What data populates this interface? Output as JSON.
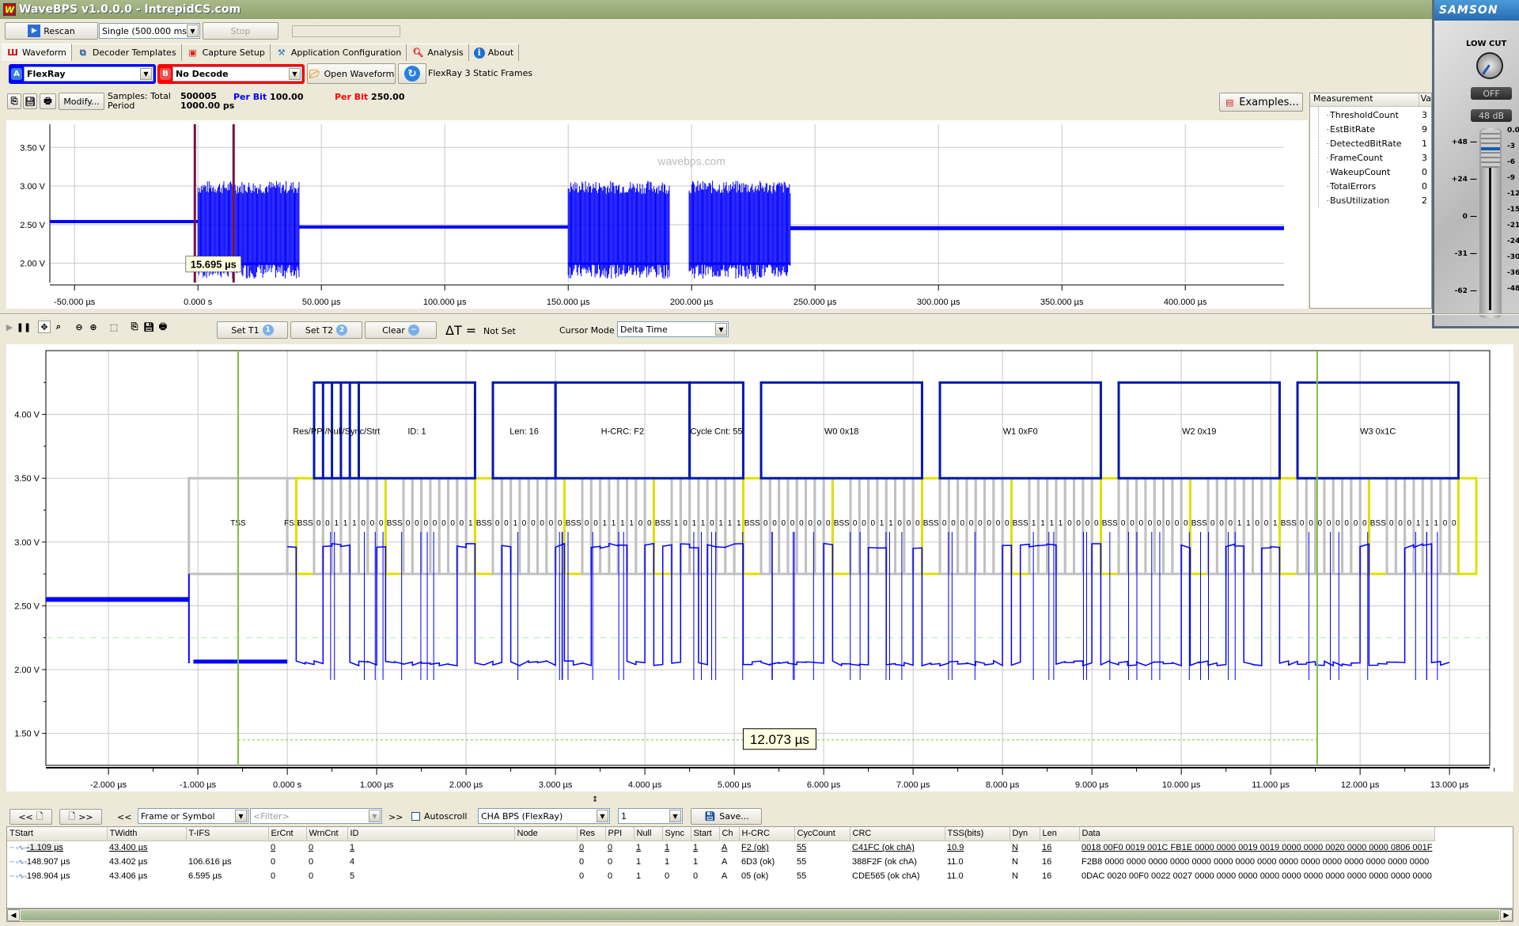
{
  "window": {
    "title": "WaveBPS v1.0.0.0 - IntrepidCS.com",
    "app_icon": "W"
  },
  "toolbar": {
    "rescan_label": "Rescan",
    "capture_mode": "Single (500.000 ms)",
    "stop_label": "Stop",
    "status_text": ""
  },
  "tabs": [
    {
      "label": "Waveform",
      "icon": "waveform-icon",
      "active": true
    },
    {
      "label": "Decoder Templates",
      "icon": "decoder-templates-icon"
    },
    {
      "label": "Capture Setup",
      "icon": "capture-setup-icon"
    },
    {
      "label": "Application Configuration",
      "icon": "app-config-icon"
    },
    {
      "label": "Analysis",
      "icon": "analysis-icon"
    },
    {
      "label": "About",
      "icon": "info-icon"
    }
  ],
  "decoders": {
    "a_badge": "A",
    "a_value": "FlexRay",
    "a_color": "#0000ff",
    "b_badge": "B",
    "b_value": "No Decode",
    "b_color": "#ff0000",
    "open_waveform_label": "Open Waveform",
    "waveform_name": "FlexRay 3 Static Frames"
  },
  "samples": {
    "modify_label": "Modify...",
    "samples_label": "Samples: Total",
    "period_label": "Period",
    "total": "500005",
    "period": "1000.00 ps",
    "a_perbit_label": "Per Bit",
    "a_perbit_value": "100.00",
    "b_perbit_label": "Per Bit",
    "b_perbit_value": "250.00",
    "examples_label": "Examples..."
  },
  "overview": {
    "watermark": "wavebps.com",
    "y_ticks": [
      "3.50 V",
      "3.00 V",
      "2.50 V",
      "2.00 V"
    ],
    "x_ticks": [
      "-50.000 µs",
      "0.000 s",
      "50.000 µs",
      "100.000 µs",
      "150.000 µs",
      "200.000 µs",
      "250.000 µs",
      "300.000 µs",
      "350.000 µs",
      "400.000 µs"
    ],
    "cursor_delta": "15.695 µs",
    "bursts": [
      [
        0,
        41
      ],
      [
        150,
        191
      ],
      [
        199,
        240
      ]
    ]
  },
  "measurements": {
    "header_name": "Measurement",
    "header_value": "Va",
    "items": [
      {
        "name": "ThresholdCount",
        "value": "3"
      },
      {
        "name": "EstBitRate",
        "value": "9"
      },
      {
        "name": "DetectedBitRate",
        "value": "1"
      },
      {
        "name": "FrameCount",
        "value": "3"
      },
      {
        "name": "WakeupCount",
        "value": "0"
      },
      {
        "name": "TotalErrors",
        "value": "0"
      },
      {
        "name": "BusUtilization",
        "value": "2"
      }
    ]
  },
  "detail_toolbar": {
    "set_t1_label": "Set T1",
    "set_t2_label": "Set T2",
    "clear_label": "Clear",
    "delta_t_label": "ΔT =",
    "delta_t_value": "Not Set",
    "cursor_mode_label": "Cursor Mode",
    "cursor_mode_value": "Delta Time"
  },
  "detail": {
    "y_ticks": [
      "4.00 V",
      "3.50 V",
      "3.00 V",
      "2.50 V",
      "2.00 V",
      "1.50 V"
    ],
    "x_ticks": [
      "-2.000 µs",
      "-1.000 µs",
      "0.000 s",
      "1.000 µs",
      "2.000 µs",
      "3.000 µs",
      "4.000 µs",
      "5.000 µs",
      "6.000 µs",
      "7.000 µs",
      "8.000 µs",
      "9.000 µs",
      "10.000 µs",
      "11.000 µs",
      "12.000 µs",
      "13.000 µs"
    ],
    "cursor_delta": "12.073 µs",
    "frame_fields": [
      {
        "label": "Res/PPI/Null/Sync/Strt",
        "start": 0.3,
        "end": 0.8
      },
      {
        "label": "ID: 1",
        "start": 0.8,
        "end": 2.1
      },
      {
        "label": "Len: 16",
        "start": 2.3,
        "end": 3.0
      },
      {
        "label": "H-CRC: F2",
        "start": 3.0,
        "end": 4.5
      },
      {
        "label": "Cycle Cnt: 55",
        "start": 4.5,
        "end": 5.1
      },
      {
        "label": "W0 0x18",
        "start": 5.3,
        "end": 7.1
      },
      {
        "label": "W1 0xF0",
        "start": 7.3,
        "end": 9.1
      },
      {
        "label": "W2 0x19",
        "start": 9.3,
        "end": 11.1
      },
      {
        "label": "W3 0x1C",
        "start": 11.3,
        "end": 13.1
      }
    ],
    "tss_label": "TSS",
    "fss_label": "FSS",
    "bss_label": "BSS",
    "byte_bits": [
      "00111000",
      "00000001",
      "00100000",
      "00111100",
      "10110111",
      "00000000",
      "00011000",
      "00000000",
      "11110000",
      "00000000",
      "00011001",
      "00000000",
      "00011100"
    ]
  },
  "table_toolbar": {
    "prev_label": "<<",
    "next_label": ">>",
    "filter_prev": "<<",
    "filter_type": "Frame or Symbol",
    "filter_placeholder": "<Filter>",
    "filter_next": ">>",
    "autoscroll_label": "Autoscroll",
    "channel": "CHA BPS (FlexRay)",
    "count": "1",
    "save_label": "Save..."
  },
  "table": {
    "columns": [
      "TStart",
      "TWidth",
      "T-IFS",
      "ErCnt",
      "WrnCnt",
      "ID",
      "Node",
      "Res",
      "PPI",
      "Null",
      "Sync",
      "Start",
      "Ch",
      "H-CRC",
      "CycCount",
      "CRC",
      "TSS(bits)",
      "Dyn",
      "Len",
      "Data"
    ],
    "rows": [
      [
        "-1.109 µs",
        "43.400 µs",
        "",
        "0",
        "0",
        "1",
        "",
        "0",
        "0",
        "1",
        "1",
        "1",
        "A",
        "F2 (ok)",
        "55",
        "C41FC (ok chA)",
        "10.9",
        "N",
        "16",
        "0018 00F0 0019 001C FB1E 0000 0000 0019 0019 0000 0000 0020 0000 0000 0806 001F"
      ],
      [
        "148.907 µs",
        "43.402 µs",
        "106.616 µs",
        "0",
        "0",
        "4",
        "",
        "0",
        "0",
        "1",
        "1",
        "1",
        "A",
        "6D3 (ok)",
        "55",
        "388F2F (ok chA)",
        "11.0",
        "N",
        "16",
        "F2B8 0000 0000 0000 0000 0000 0000 0000 0000 0000 0000 0000 0000 0000 0000 0000"
      ],
      [
        "198.904 µs",
        "43.406 µs",
        "6.595 µs",
        "0",
        "0",
        "5",
        "",
        "0",
        "0",
        "1",
        "0",
        "0",
        "A",
        "05 (ok)",
        "55",
        "CDE565 (ok chA)",
        "11.0",
        "N",
        "16",
        "0DAC 0020 00F0 0022 0027 0000 0000 0000 0000 0000 0000 0000 0000 0000 0000 0000"
      ]
    ]
  },
  "samson": {
    "brand": "SAMSON",
    "low_cut_label": "LOW CUT",
    "low_cut_value": "OFF",
    "gain_value": "48 dB",
    "gain_scale": [
      "+48",
      "+24",
      "0",
      "-31",
      "-62"
    ],
    "meter_scale": [
      "0.0",
      "-3",
      "-6",
      "-9",
      "-12",
      "-15",
      "-21",
      "-24",
      "-30",
      "-36",
      "-48"
    ]
  }
}
